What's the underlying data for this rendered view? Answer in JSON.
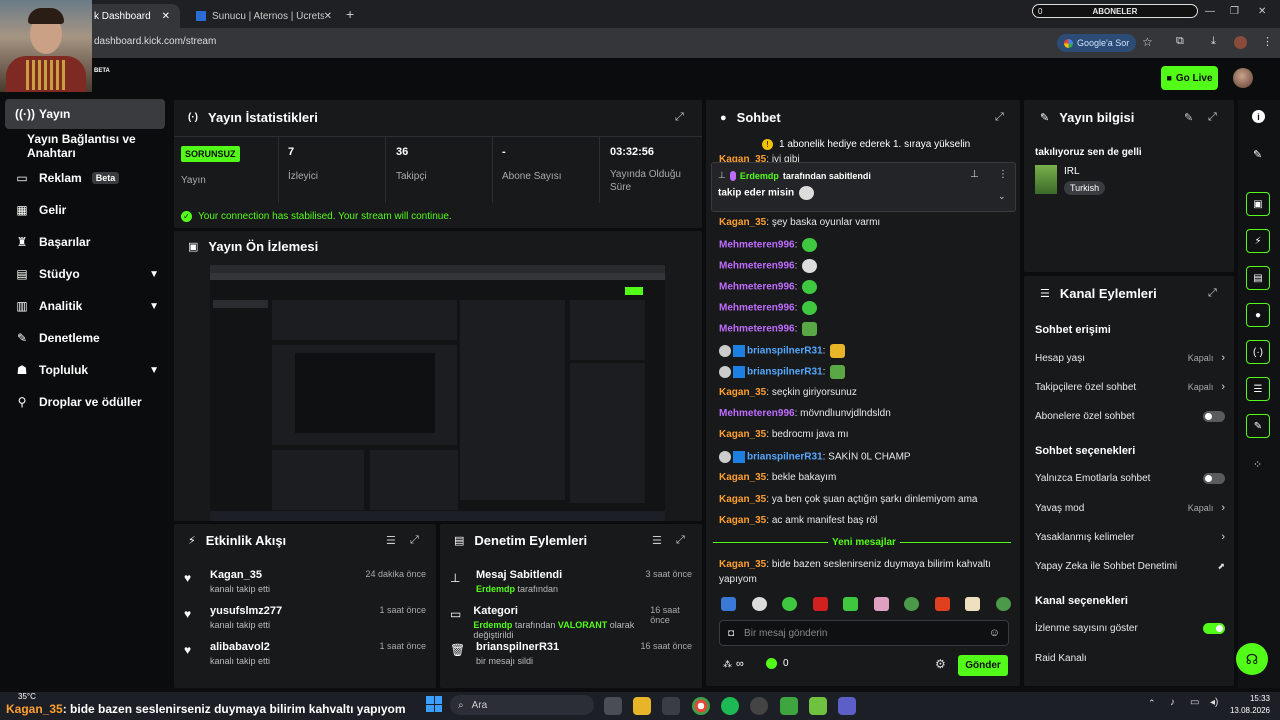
{
  "browser": {
    "tabs": [
      {
        "label": "k Dashboard"
      },
      {
        "label": "Sunucu | Aternos | Ücretsiz Min"
      }
    ],
    "url": "dashboard.kick.com/stream",
    "google_button": "Google'a Sor",
    "overlay_title": "ABONELER",
    "overlay_count": "0"
  },
  "header": {
    "beta": "BETA",
    "go_live": "Go Live"
  },
  "sidebar": {
    "items": [
      {
        "label": "Yayın",
        "icon": "broadcast-icon"
      },
      {
        "label": "Yayın Bağlantısı ve Anahtarı"
      },
      {
        "label": "Reklam",
        "badge": "Beta",
        "icon": "ad-icon"
      },
      {
        "label": "Gelir",
        "icon": "revenue-icon"
      },
      {
        "label": "Başarılar",
        "icon": "trophy-icon"
      },
      {
        "label": "Stüdyo",
        "icon": "studio-icon"
      },
      {
        "label": "Analitik",
        "icon": "analytics-icon"
      },
      {
        "label": "Denetleme",
        "icon": "moderation-icon"
      },
      {
        "label": "Topluluk",
        "icon": "community-icon"
      },
      {
        "label": "Droplar ve ödüller",
        "icon": "drops-icon"
      }
    ]
  },
  "stats": {
    "title": "Yayın İstatistikleri",
    "status": "SORUNSUZ",
    "status_label": "Yayın",
    "items": [
      {
        "value": "7",
        "label": "İzleyici"
      },
      {
        "value": "36",
        "label": "Takipçi"
      },
      {
        "value": "-",
        "label": "Abone Sayısı"
      },
      {
        "value": "03:32:56",
        "label": "Yayında Olduğu Süre"
      }
    ],
    "connection": "Your connection has stabilised. Your stream will continue."
  },
  "preview": {
    "title": "Yayın Ön İzlemesi"
  },
  "activity": {
    "title": "Etkinlik Akışı",
    "items": [
      {
        "name": "Kagan_35",
        "sub": "kanalı takip etti",
        "time": "24 dakika önce"
      },
      {
        "name": "yusufslmz277",
        "sub": "kanalı takip etti",
        "time": "1 saat önce"
      },
      {
        "name": "alibabavol2",
        "sub": "kanalı takip etti",
        "time": "1 saat önce"
      }
    ]
  },
  "moderation": {
    "title": "Denetim Eylemleri",
    "items": [
      {
        "name": "Mesaj Sabitlendi",
        "actor": "Erdemdp",
        "sub": "tarafından",
        "time": "3 saat önce"
      },
      {
        "name": "Kategori",
        "actor": "Erdemdp",
        "sub": "tarafından",
        "highlight": "VALORANT",
        "sub2": "olarak değiştirildi",
        "time": "16 saat önce"
      },
      {
        "name": "brianspilnerR31",
        "sub": "bir mesajı sildi",
        "time": "16 saat önce"
      }
    ]
  },
  "chat": {
    "title": "Sohbet",
    "gift_banner": "1 abonelik hediye ederek 1. sıraya yükselin",
    "pinned_by_user": "Erdemdp",
    "pinned_by_text": "tarafından sabitlendi",
    "pinned_message": "takip eder misin",
    "partial_line": {
      "user": "Kagan_35",
      "text": "iyi gibi"
    },
    "messages": [
      {
        "user": "Kagan_35",
        "color": "u1",
        "text": "şey baska oyunlar varmı"
      },
      {
        "user": "Mehmeteren996",
        "color": "u2",
        "text": ""
      },
      {
        "user": "Mehmeteren996",
        "color": "u2",
        "text": ""
      },
      {
        "user": "Mehmeteren996",
        "color": "u2",
        "text": ""
      },
      {
        "user": "Mehmeteren996",
        "color": "u2",
        "text": ""
      },
      {
        "user": "Mehmeteren996",
        "color": "u2",
        "text": ""
      },
      {
        "user": "brianspilnerR31",
        "color": "u3",
        "text": ""
      },
      {
        "user": "brianspilnerR31",
        "color": "u3",
        "text": ""
      },
      {
        "user": "Kagan_35",
        "color": "u1",
        "text": "seçkin giriyorsunuz"
      },
      {
        "user": "Mehmeteren996",
        "color": "u2",
        "text": "mövndlıunvjdlndsldn"
      },
      {
        "user": "Kagan_35",
        "color": "u1",
        "text": "bedrocmı java mı"
      },
      {
        "user": "brianspilnerR31",
        "color": "u3",
        "text": "SAKİN 0L CHAMP"
      },
      {
        "user": "Kagan_35",
        "color": "u1",
        "text": "bekle bakayım"
      },
      {
        "user": "Kagan_35",
        "color": "u1",
        "text": "ya ben çok şuan açtığın şarkı dinlemiyom ama"
      },
      {
        "user": "Kagan_35",
        "color": "u1",
        "text": "ac amk manifest baş röl"
      }
    ],
    "new_messages": "Yeni mesajlar",
    "last_user": "Kagan_35",
    "last_text": "bide bazen seslenirseniz duymaya bilirim kahvaltı yapıyom",
    "input_placeholder": "Bir mesaj gönderin",
    "infinity": "∞",
    "points": "0",
    "send": "Gönder"
  },
  "stream_info": {
    "title": "Yayın bilgisi",
    "stream_title": "takılıyoruz sen de gelli",
    "category": "IRL",
    "tag": "Turkish"
  },
  "channel_actions": {
    "title": "Kanal Eylemleri",
    "chat_access": "Sohbet erişimi",
    "account_age": {
      "label": "Hesap yaşı",
      "value": "Kapalı"
    },
    "followers_only": {
      "label": "Takipçilere özel sohbet",
      "value": "Kapalı"
    },
    "subs_only": {
      "label": "Abonelere özel sohbet"
    },
    "chat_options": "Sohbet seçenekleri",
    "emote_only": {
      "label": "Yalnızca Emotlarla sohbet"
    },
    "slow_mode": {
      "label": "Yavaş mod",
      "value": "Kapalı"
    },
    "banned_words": {
      "label": "Yasaklanmış kelimeler"
    },
    "ai_moderation": {
      "label": "Yapay Zeka ile Sohbet Denetimi"
    },
    "channel_options": "Kanal seçenekleri",
    "show_viewers": {
      "label": "İzlenme sayısını göster"
    },
    "raid": {
      "label": "Raid Kanalı"
    }
  },
  "ticker": {
    "user": "Kagan_35",
    "text": ": bide bazen seslenirseniz duymaya bilirim kahvaltı yapıyom",
    "weather": "35°C"
  },
  "taskbar": {
    "search": "Ara",
    "time": "15:33",
    "date": "13.08.2026"
  },
  "colors": {
    "accent": "#53fc18",
    "panel": "#18191b",
    "bg": "#0b0c0d"
  }
}
